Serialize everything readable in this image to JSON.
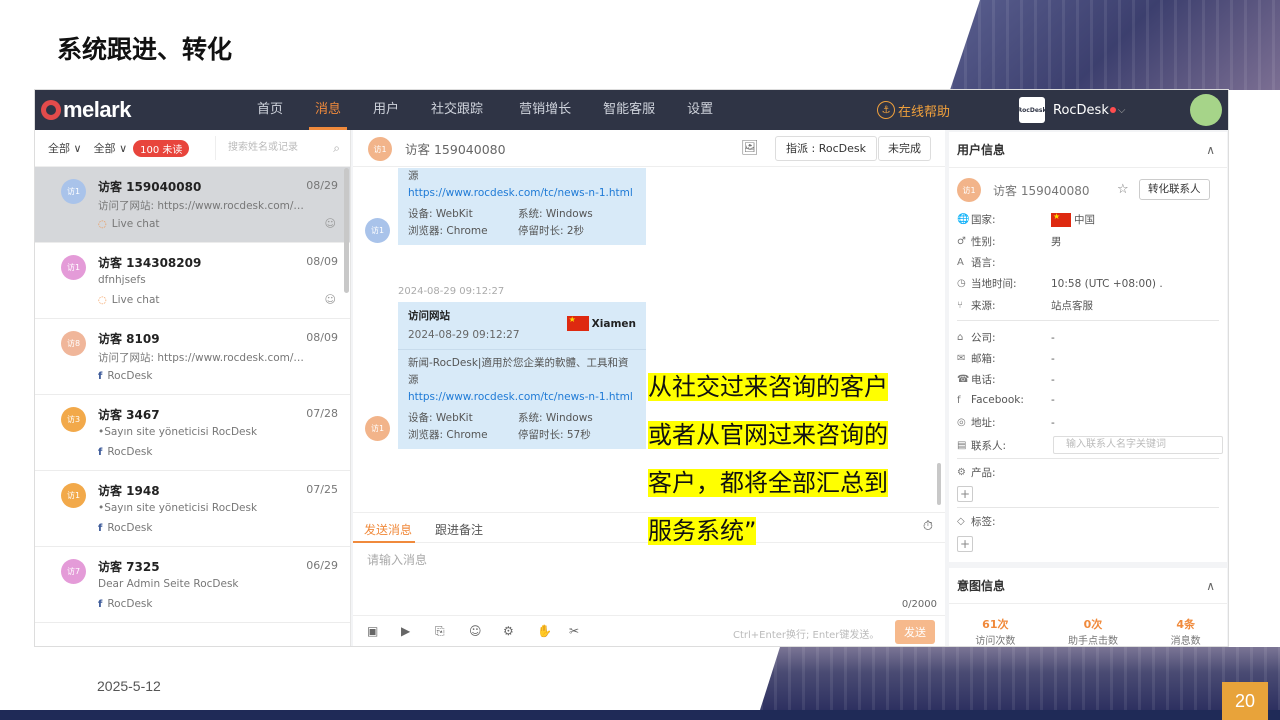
{
  "slide": {
    "title": "系统跟进、转化",
    "date": "2025-5-12",
    "page_number": "20"
  },
  "app": {
    "logo_text": "melark",
    "nav": [
      {
        "label": "首页",
        "active": false
      },
      {
        "label": "消息",
        "active": true
      },
      {
        "label": "用户",
        "active": false
      },
      {
        "label": "社交跟踪",
        "active": false
      },
      {
        "label": "营销增长",
        "active": false
      },
      {
        "label": "智能客服",
        "active": false
      },
      {
        "label": "设置",
        "active": false
      }
    ],
    "help_label": "在线帮助",
    "brand_logo_text": "RocDesk",
    "brand_name": "RocDesk"
  },
  "list": {
    "filter_all_1": "全部",
    "filter_all_2": "全部",
    "unread_badge": "100 未读",
    "search_placeholder": "搜索姓名或记录",
    "conversations": [
      {
        "avatar": "访1",
        "avatar_color": "#a9c3ea",
        "name": "访客 159040080",
        "date": "08/29",
        "preview": "访问了网站:  https://www.rocdesk.com/tc...",
        "channel": "Live chat",
        "channel_type": "live",
        "selected": true
      },
      {
        "avatar": "访1",
        "avatar_color": "#e49bd8",
        "name": "访客 134308209",
        "date": "08/09",
        "preview": "dfnhjsefs",
        "channel": "Live chat",
        "channel_type": "live",
        "selected": false
      },
      {
        "avatar": "访8",
        "avatar_color": "#f0b69a",
        "name": "访客 8109",
        "date": "08/09",
        "preview": "访问了网站:  https://www.rocdesk.com/e...",
        "channel": "RocDesk",
        "channel_type": "fb",
        "selected": false
      },
      {
        "avatar": "访3",
        "avatar_color": "#f2a94a",
        "name": "访客 3467",
        "date": "07/28",
        "preview": "•Sayın site yöneticisi RocDesk",
        "channel": "RocDesk",
        "channel_type": "fb",
        "selected": false
      },
      {
        "avatar": "访1",
        "avatar_color": "#f2a94a",
        "name": "访客 1948",
        "date": "07/25",
        "preview": "•Sayın site yöneticisi RocDesk",
        "channel": "RocDesk",
        "channel_type": "fb",
        "selected": false
      },
      {
        "avatar": "访7",
        "avatar_color": "#e49bd8",
        "name": "访客 7325",
        "date": "06/29",
        "preview": "Dear Admin Seite RocDesk",
        "channel": "RocDesk",
        "channel_type": "fb",
        "selected": false
      }
    ]
  },
  "chat": {
    "header_avatar": "访1",
    "header_title": "访客 159040080",
    "assign_label": "指派 : RocDesk",
    "unfinished_label": "未完成",
    "card1": {
      "top_text": "源",
      "link": "https://www.rocdesk.com/tc/news-n-1.html",
      "device_label": "设备:  WebKit",
      "os_label": "系统:  Windows",
      "browser_label": "浏览器:  Chrome",
      "stay_label": "停留时长:  2秒",
      "avatar": "访1"
    },
    "timestamp": "2024-08-29 09:12:27",
    "card2": {
      "title": "访问网站",
      "date": "2024-08-29 09:12:27",
      "city": "Xiamen",
      "desc_line1": "新闻-RocDesk|適用於您企業的軟體、工具和資",
      "desc_line2": "源",
      "link": "https://www.rocdesk.com/tc/news-n-1.html",
      "device_label": "设备:  WebKit",
      "os_label": "系统:  Windows",
      "browser_label": "浏览器:  Chrome",
      "stay_label": "停留时长:  57秒",
      "avatar": "访1"
    },
    "composer": {
      "tab_send": "发送消息",
      "tab_note": "跟进备注",
      "placeholder": "请输入消息",
      "counter": "0/2000",
      "hint": "Ctrl+Enter换行;  Enter键发送。",
      "send_label": "发送"
    }
  },
  "user_info": {
    "title": "用户信息",
    "avatar": "访1",
    "visitor_name": "访客 159040080",
    "convert_label": "转化联系人",
    "rows": [
      {
        "label": "国家:",
        "value": "中国"
      },
      {
        "label": "性别:",
        "value": "男"
      },
      {
        "label": "语言:",
        "value": ""
      },
      {
        "label": "当地时间:",
        "value": "10:58 (UTC +08:00) ."
      },
      {
        "label": "来源:",
        "value": "站点客服"
      }
    ],
    "rows2": [
      {
        "label": "公司:",
        "value": "-"
      },
      {
        "label": "邮箱:",
        "value": "-"
      },
      {
        "label": "电话:",
        "value": "-"
      },
      {
        "label": "Facebook:",
        "value": "-"
      },
      {
        "label": "地址:",
        "value": "-"
      },
      {
        "label": "联系人:",
        "value": ""
      }
    ],
    "contact_placeholder": "输入联系人名字关键词",
    "product_label": "产品:",
    "tags_label": "标签:"
  },
  "intent_info": {
    "title": "意图信息",
    "stats": [
      {
        "num": "61次",
        "label": "访问次数"
      },
      {
        "num": "0次",
        "label": "助手点击数"
      },
      {
        "num": "4条",
        "label": "消息数"
      }
    ]
  },
  "callout": {
    "line1": "从社交过来咨询的客户",
    "line2": "或者从官网过来咨询的",
    "line3": "客户，都将全部汇总到",
    "line4": "服务系统”"
  },
  "colors": {
    "accent": "#f08a3c",
    "nav_bg": "#2f3445",
    "highlight": "#ffff00",
    "page_badge": "#e8a33a"
  }
}
